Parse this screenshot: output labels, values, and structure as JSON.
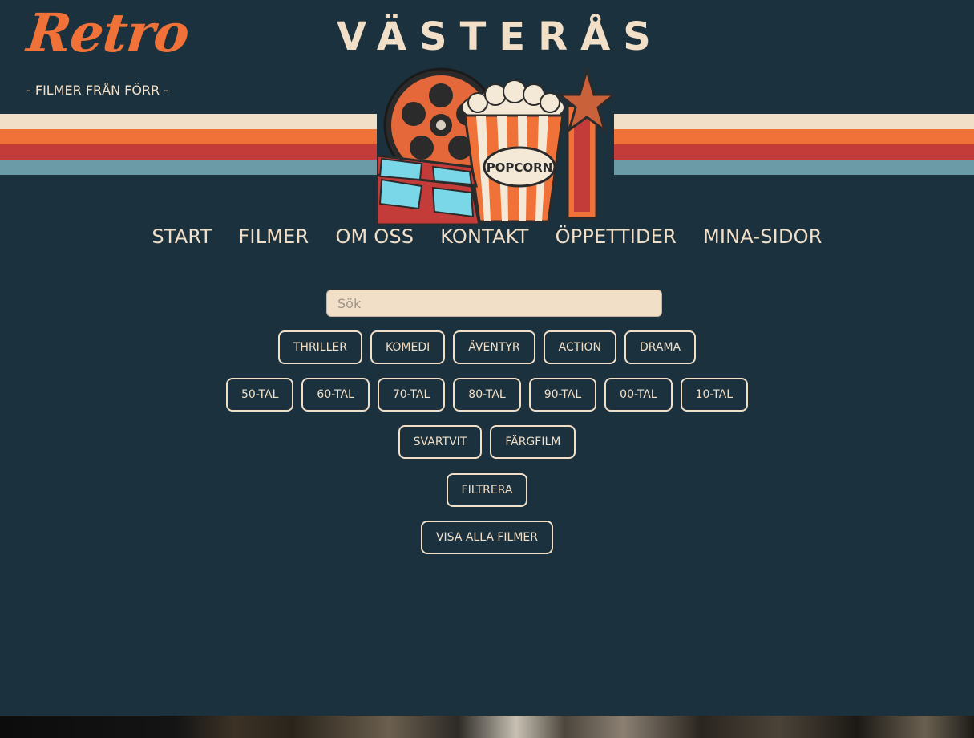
{
  "header": {
    "logo_text": "Retro",
    "tagline": "- FILMER FRÅN FÖRR -",
    "city": "VÄSTERÅS",
    "emblem_label": "POPCORN"
  },
  "stripe_colors": [
    "#f2dfc8",
    "#f07238",
    "#c33c3a",
    "#6b9ba6"
  ],
  "colors": {
    "background": "#1b313d",
    "cream": "#f2dfc8",
    "orange": "#f07238",
    "red": "#c33c3a",
    "teal": "#6b9ba6"
  },
  "nav": {
    "items": [
      "START",
      "FILMER",
      "OM OSS",
      "KONTAKT",
      "ÖPPETTIDER",
      "MINA-SIDOR"
    ]
  },
  "search": {
    "placeholder": "Sök",
    "value": ""
  },
  "filters": {
    "genres": [
      "THRILLER",
      "KOMEDI",
      "ÄVENTYR",
      "ACTION",
      "DRAMA"
    ],
    "decades": [
      "50-TAL",
      "60-TAL",
      "70-TAL",
      "80-TAL",
      "90-TAL",
      "00-TAL",
      "10-TAL"
    ],
    "formats": [
      "SVARTVIT",
      "FÄRGFILM"
    ],
    "filter_label": "FILTRERA",
    "show_all_label": "VISA ALLA FILMER"
  },
  "icons": [
    "film-reel-icon",
    "popcorn-bucket-icon",
    "3d-glasses-icon",
    "clapperboard-star-icon"
  ]
}
